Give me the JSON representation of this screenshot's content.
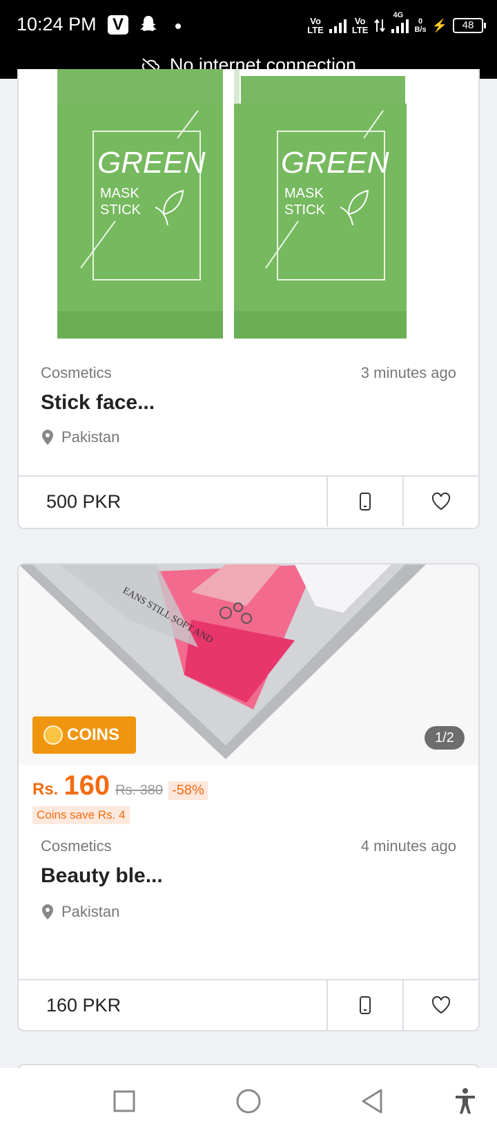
{
  "status_bar": {
    "time": "10:24 PM",
    "v_icon_letter": "V",
    "sim1": "Vo\nLTE",
    "sim2": "Vo\nLTE",
    "network_type": "4G",
    "speed_value": "0",
    "speed_unit": "B/s",
    "battery": "48"
  },
  "banner": {
    "text": "No internet connection",
    "icon": "cloud-off-icon"
  },
  "listings": [
    {
      "image_text": {
        "word": "GREEN",
        "line2": "MASK",
        "line3": "STICK"
      },
      "category": "Cosmetics",
      "time": "3 minutes ago",
      "title": "Stick face...",
      "location": "Pakistan",
      "price": "500 PKR",
      "actions": [
        "phone-icon",
        "heart-icon"
      ]
    },
    {
      "image_overlay": {
        "coins_badge": "COINS",
        "pager": "1/2"
      },
      "promo": {
        "currency": "Rs.",
        "price": "160",
        "old_price": "Rs. 380",
        "discount": "-58%",
        "coins_save": "Coins save Rs. 4"
      },
      "category": "Cosmetics",
      "time": "4 minutes ago",
      "title": "Beauty ble...",
      "location": "Pakistan",
      "price": "160 PKR",
      "actions": [
        "phone-icon",
        "heart-icon"
      ]
    }
  ],
  "nav_bar": {
    "buttons": [
      "recents-square-icon",
      "home-circle-icon",
      "back-triangle-icon",
      "accessibility-icon"
    ]
  },
  "colors": {
    "accent_orange": "#f36c12",
    "coins_badge": "#f0950f",
    "mask_green": "#76b95f"
  }
}
